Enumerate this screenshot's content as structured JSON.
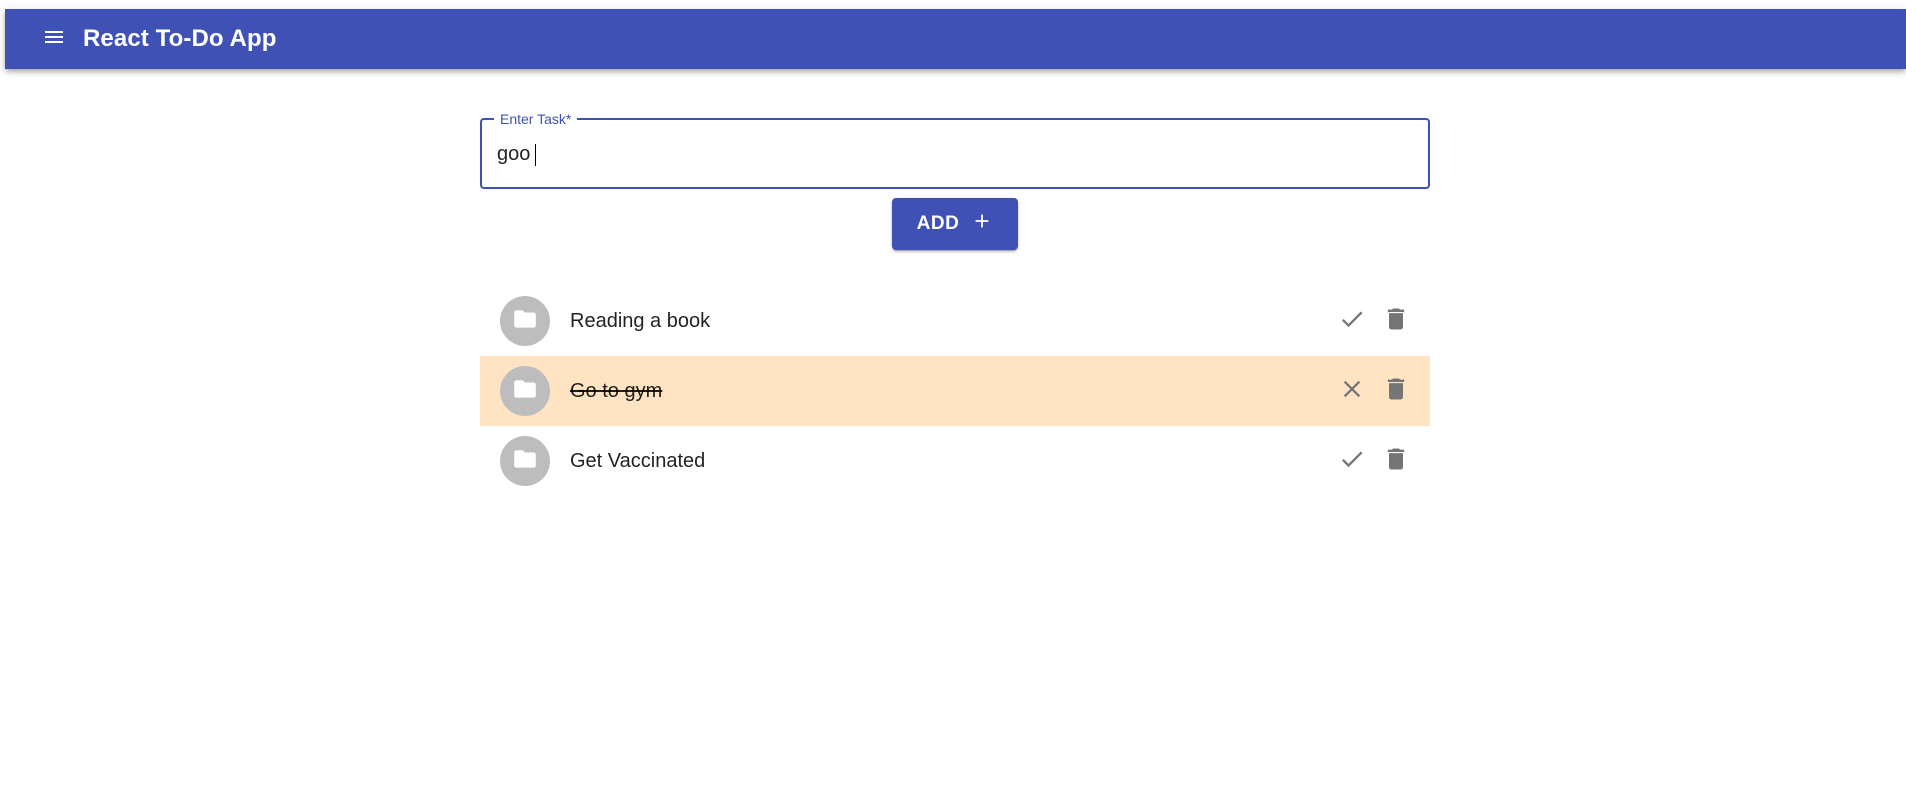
{
  "app": {
    "title": "React To-Do App",
    "menu_icon": "menu-icon",
    "accent_color": "#3f51b5"
  },
  "task_input": {
    "label": "Enter Task*",
    "value": "goo"
  },
  "add_button": {
    "label": "ADD",
    "icon": "plus-icon"
  },
  "tasks": [
    {
      "text": "Reading a book",
      "completed": false,
      "status_icon": "check-icon",
      "delete_icon": "trash-icon"
    },
    {
      "text": "Go to gym",
      "completed": true,
      "status_icon": "close-icon",
      "delete_icon": "trash-icon",
      "highlight_color": "#ffe4c4"
    },
    {
      "text": "Get Vaccinated",
      "completed": false,
      "status_icon": "check-icon",
      "delete_icon": "trash-icon"
    }
  ]
}
